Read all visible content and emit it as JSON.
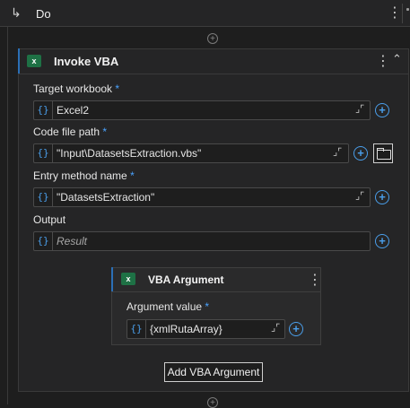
{
  "do": {
    "label": "Do",
    "arrow": "↳"
  },
  "activity": {
    "title": "Invoke VBA",
    "icon_letter": "x"
  },
  "fields": {
    "target_workbook": {
      "label": "Target workbook",
      "required": "*",
      "value": "Excel2"
    },
    "code_file_path": {
      "label": "Code file path",
      "required": "*",
      "value": "\"Input\\DatasetsExtraction.vbs\""
    },
    "entry_method_name": {
      "label": "Entry method name",
      "required": "*",
      "value": "\"DatasetsExtraction\""
    },
    "output": {
      "label": "Output",
      "placeholder": "Result"
    }
  },
  "argument": {
    "title": "VBA Argument",
    "icon_letter": "x",
    "value_label": "Argument value",
    "required": "*",
    "value": "{xmlRutaArray}"
  },
  "add_button": {
    "label": "Add VBA Argument"
  },
  "icons": {
    "brace": "{}",
    "expand": "expand-icon",
    "plus": "plus-circle-icon",
    "folder": "folder-icon",
    "menu": "more-vertical-icon",
    "collapse": "chevron-up-double-icon"
  },
  "colors": {
    "accent": "#2b6fb6",
    "brace": "#4a9eea",
    "excel": "#1e7145",
    "background": "#1e1e1e"
  }
}
